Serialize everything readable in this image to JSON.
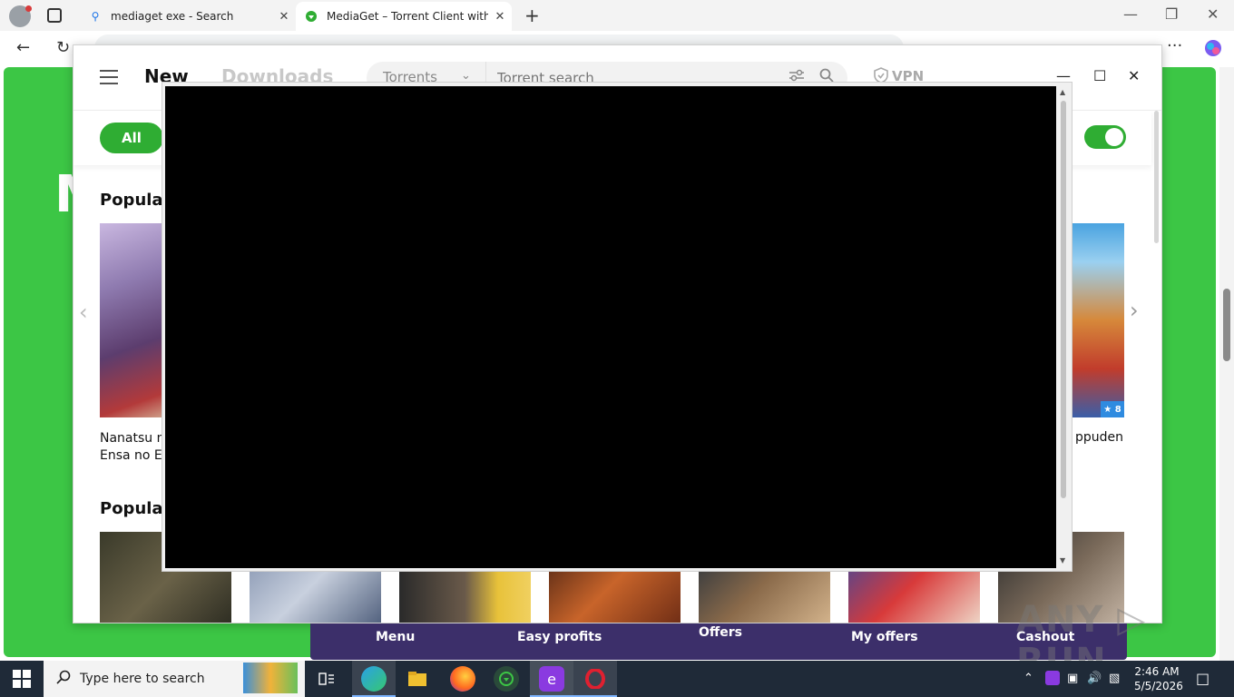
{
  "browser": {
    "tabs": [
      {
        "title": "mediaget exe - Search",
        "active": false
      },
      {
        "title": "MediaGet – Torrent Client with Se",
        "active": true
      }
    ],
    "new_tab": "+",
    "window_controls": {
      "minimize": "—",
      "restore": "❐",
      "close": "✕"
    },
    "toolbar": {
      "back": "←",
      "reload": "↻",
      "more": "···"
    }
  },
  "app": {
    "nav": {
      "new": "New",
      "downloads": "Downloads"
    },
    "search": {
      "category": "Torrents",
      "placeholder": "Torrent search"
    },
    "vpn": "VPN",
    "window_controls": {
      "minimize": "—",
      "maximize": "☐",
      "close": "✕"
    },
    "filter_all": "All",
    "sections": [
      {
        "title": "Popula"
      },
      {
        "title": "Popula"
      }
    ],
    "caption_left_line1": "Nanatsu n",
    "caption_left_line2": "Ensa no E",
    "caption_right": "ppuden",
    "rating": "★ 8"
  },
  "bottom_bar": {
    "items": [
      "Menu",
      "Easy profits",
      "Offers",
      "My offers",
      "Cashout"
    ]
  },
  "watermark": "ANY ▷ RUN",
  "taskbar": {
    "search_placeholder": "Type here to search",
    "time": "2:46 AM",
    "date": "5/5/2026"
  },
  "colors": {
    "green": "#3cc645",
    "accent_green": "#2fad33",
    "purple_bar": "#3c2f6a",
    "taskbar": "#1f2a38"
  }
}
